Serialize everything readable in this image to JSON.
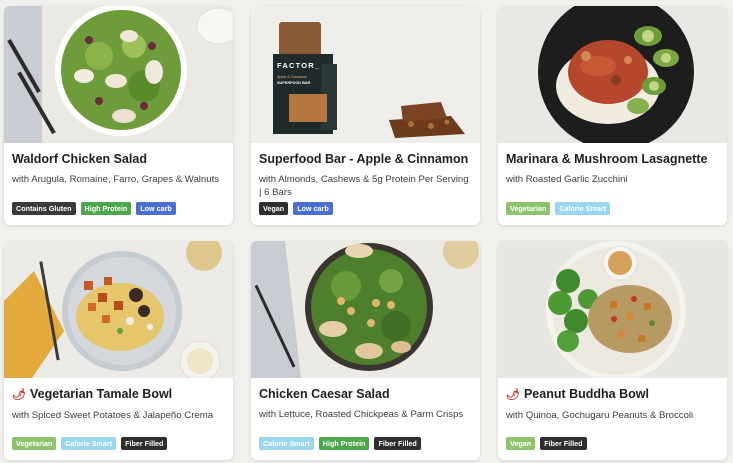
{
  "tag_colors": {
    "Contains Gluten": "#3a3a3a",
    "High Protein": "#4ba64c",
    "Low carb": "#4b6ed1",
    "Vegan": "#2f2f2f",
    "Vegetarian": "#8ec36e",
    "Calorie Smart": "#9ad6ee",
    "Fiber Filled": "#2f2f2f"
  },
  "meals": [
    {
      "title": "Waldorf Chicken Salad",
      "description": "with Arugula, Romaine, Farro, Grapes & Walnuts",
      "spicy": false,
      "tags": [
        "Contains Gluten",
        "High Protein",
        "Low carb"
      ]
    },
    {
      "title": "Superfood Bar - Apple & Cinnamon",
      "description": "with Almonds, Cashews & 5g Protein Per Serving | 6 Bars",
      "spicy": false,
      "brand_text": "FACTOR_",
      "package_text": [
        "Apple & Cinnamon",
        "SUPERFOOD BAR"
      ],
      "tags": [
        "Vegan",
        "Low carb"
      ]
    },
    {
      "title": "Marinara & Mushroom Lasagnette",
      "description": "with Roasted Garlic Zucchini",
      "spicy": false,
      "tags": [
        "Vegetarian",
        "Calorie Smart"
      ]
    },
    {
      "title": "Vegetarian Tamale Bowl",
      "description": "with Spiced Sweet Potatoes & Jalapeño Crema",
      "spicy": true,
      "tags": [
        "Vegetarian",
        "Calorie Smart",
        "Fiber Filled"
      ]
    },
    {
      "title": "Chicken Caesar Salad",
      "description": "with Lettuce, Roasted Chickpeas & Parm Crisps",
      "spicy": false,
      "tags": [
        "Calorie Smart",
        "High Protein",
        "Fiber Filled"
      ]
    },
    {
      "title": "Peanut Buddha Bowl",
      "description": "with Quinoa, Gochugaru Peanuts & Broccoli",
      "spicy": true,
      "tags": [
        "Vegan",
        "Fiber Filled"
      ]
    }
  ]
}
